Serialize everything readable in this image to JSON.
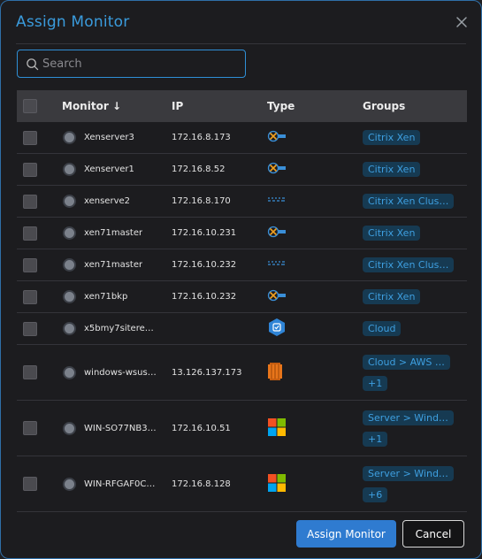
{
  "dialog": {
    "title": "Assign Monitor",
    "close_icon": "close-icon"
  },
  "search": {
    "placeholder": "Search",
    "value": "",
    "icon": "search-icon"
  },
  "table": {
    "headers": {
      "monitor": "Monitor",
      "sort_indicator": "↓",
      "ip": "IP",
      "type": "Type",
      "groups": "Groups"
    },
    "rows": [
      {
        "monitor": "Xenserver3",
        "ip": "172.16.8.173",
        "type": "xenserver-icon",
        "groups": [
          "Citrix Xen"
        ]
      },
      {
        "monitor": "Xenserver1",
        "ip": "172.16.8.52",
        "type": "xenserver-icon",
        "groups": [
          "Citrix Xen"
        ]
      },
      {
        "monitor": "xenserve2",
        "ip": "172.16.8.170",
        "type": "citrix-icon",
        "groups": [
          "Citrix Xen Clus…"
        ]
      },
      {
        "monitor": "xen71master",
        "ip": "172.16.10.231",
        "type": "xenserver-icon",
        "groups": [
          "Citrix Xen"
        ]
      },
      {
        "monitor": "xen71master",
        "ip": "172.16.10.232",
        "type": "citrix-icon",
        "groups": [
          "Citrix Xen Clus…"
        ]
      },
      {
        "monitor": "xen71bkp",
        "ip": "172.16.10.232",
        "type": "xenserver-icon",
        "groups": [
          "Citrix Xen"
        ]
      },
      {
        "monitor": "x5bmy7siterec…",
        "ip": "",
        "type": "cloud-hexagon-icon",
        "groups": [
          "Cloud"
        ]
      },
      {
        "monitor": "windows-wsus…",
        "ip": "13.126.137.173",
        "type": "aws-ec2-icon",
        "groups": [
          "Cloud > AWS …",
          "+1"
        ]
      },
      {
        "monitor": "WIN-SO77NB3G…",
        "ip": "172.16.10.51",
        "type": "windows-icon",
        "groups": [
          "Server > Wind…",
          "+1"
        ]
      },
      {
        "monitor": "WIN-RFGAF0C0…",
        "ip": "172.16.8.128",
        "type": "windows-icon",
        "groups": [
          "Server > Wind…",
          "+6"
        ]
      }
    ]
  },
  "footer": {
    "assign_label": "Assign Monitor",
    "cancel_label": "Cancel"
  },
  "colors": {
    "accent": "#3a9bdc",
    "primary_button": "#2f7bd0",
    "tag_bg": "#163a52",
    "tag_text": "#3e9fe0",
    "status_dot": "#7b818b"
  }
}
